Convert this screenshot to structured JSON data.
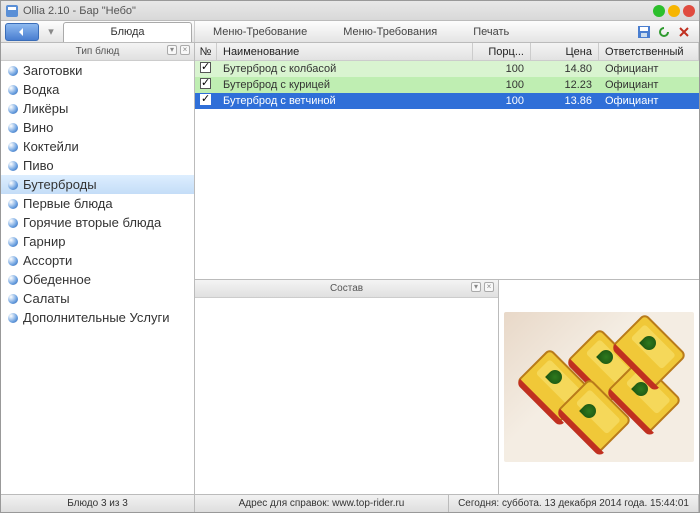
{
  "window": {
    "title": "Ollia 2.10 - Бар \"Небо\""
  },
  "toolbar": {
    "active_tab": "Блюда",
    "menu": {
      "item1": "Меню-Требование",
      "item2": "Меню-Требования",
      "item3": "Печать"
    }
  },
  "sidebar": {
    "header": "Тип блюд",
    "selected_index": 6,
    "items": [
      {
        "label": "Заготовки"
      },
      {
        "label": "Водка"
      },
      {
        "label": "Ликёры"
      },
      {
        "label": "Вино"
      },
      {
        "label": "Коктейли"
      },
      {
        "label": "Пиво"
      },
      {
        "label": "Бутерброды"
      },
      {
        "label": "Первые блюда"
      },
      {
        "label": "Горячие вторые блюда"
      },
      {
        "label": "Гарнир"
      },
      {
        "label": "Ассорти"
      },
      {
        "label": "Обеденное"
      },
      {
        "label": "Салаты"
      },
      {
        "label": "Дополнительные Услуги"
      }
    ]
  },
  "grid": {
    "columns": {
      "num": "№",
      "name": "Наименование",
      "portion": "Порц...",
      "price": "Цена",
      "responsible": "Ответственный"
    },
    "rows": [
      {
        "checked": true,
        "name": "Бутерброд с колбасой",
        "portion": "100",
        "price": "14.80",
        "responsible": "Официант"
      },
      {
        "checked": true,
        "name": "Бутерброд с курицей",
        "portion": "100",
        "price": "12.23",
        "responsible": "Официант"
      },
      {
        "checked": true,
        "name": "Бутерброд с ветчиной",
        "portion": "100",
        "price": "13.86",
        "responsible": "Официант"
      }
    ],
    "selected_index": 2
  },
  "compose": {
    "header": "Состав"
  },
  "status": {
    "left": "Блюдо 3 из 3",
    "center": "Адрес для справок: www.top-rider.ru",
    "right": "Сегодня: суббота. 13 декабря 2014 года. 15:44:01"
  }
}
